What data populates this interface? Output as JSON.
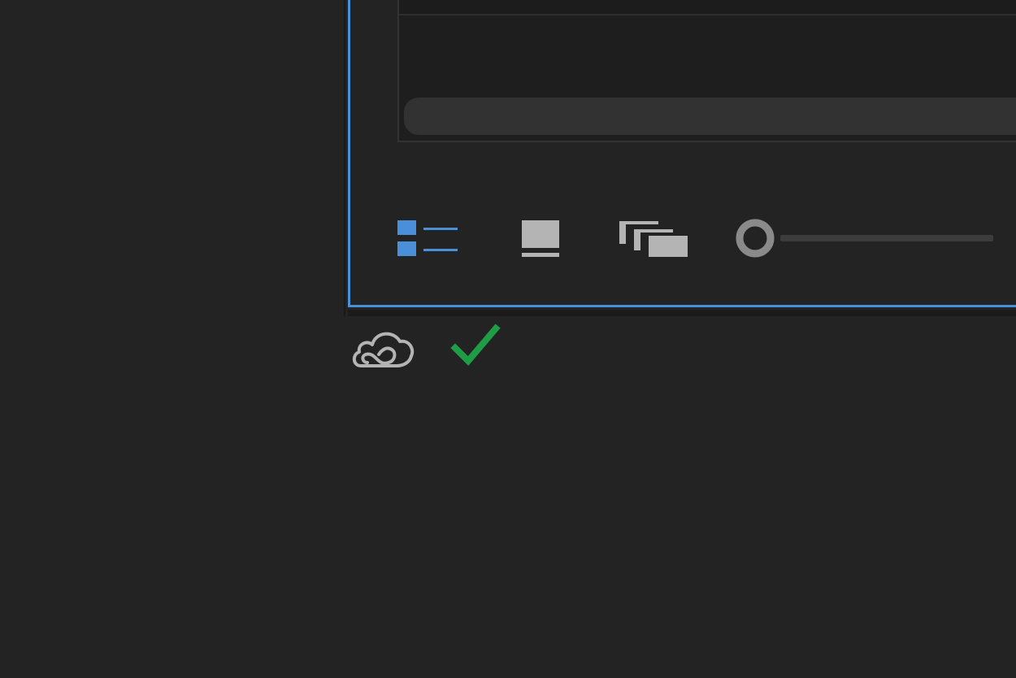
{
  "panel": {
    "focused": true,
    "accent_color": "#4a8fd9"
  },
  "toolbar": {
    "view_buttons": [
      {
        "name": "list-view",
        "icon": "list-view-icon",
        "active": true,
        "color": "#4a8fd9"
      },
      {
        "name": "icon-view",
        "icon": "icon-view-icon",
        "active": false,
        "color": "#b4b4b4"
      },
      {
        "name": "freeform-view",
        "icon": "freeform-view-icon",
        "active": false,
        "color": "#b4b4b4"
      }
    ],
    "zoom": {
      "icon": "zoom-slider-handle",
      "value": 0
    }
  },
  "status": {
    "creative_cloud_icon": "creative-cloud-icon",
    "check_icon": "checkmark-icon",
    "check_color": "#1e9c46"
  }
}
